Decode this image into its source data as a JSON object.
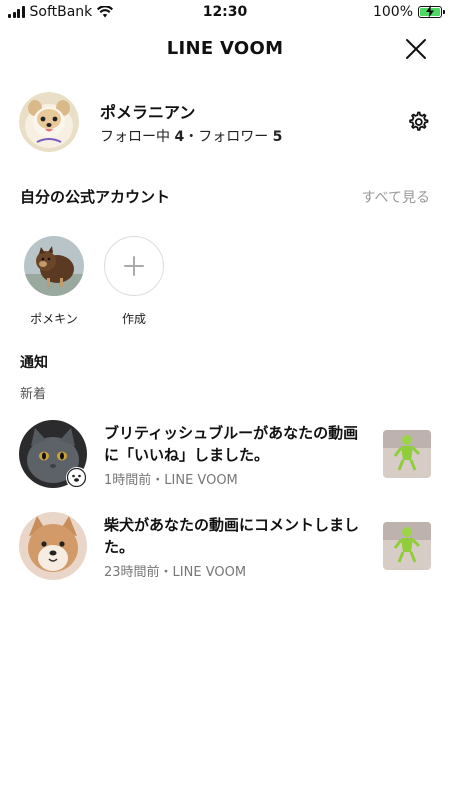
{
  "status_bar": {
    "carrier": "SoftBank",
    "time": "12:30",
    "battery": "100%"
  },
  "header": {
    "title": "LINE VOOM"
  },
  "profile": {
    "name": "ポメラニアン",
    "following_label": "フォロー中",
    "following_count": "4",
    "separator": "・",
    "followers_label": "フォロワー",
    "followers_count": "5"
  },
  "official_accounts": {
    "title": "自分の公式アカウント",
    "see_all": "すべて見る",
    "items": [
      {
        "label": "ポメキン"
      },
      {
        "label": "作成"
      }
    ]
  },
  "notifications": {
    "title": "通知",
    "subtitle": "新着",
    "items": [
      {
        "text": "ブリティッシュブルーがあなたの動画に「いいね」しました。",
        "meta": "1時間前・LINE VOOM"
      },
      {
        "text": "柴犬があなたの動画にコメントしました。",
        "meta": "23時間前・LINE VOOM"
      }
    ]
  },
  "colors": {
    "battery_fill": "#4cd964",
    "secondary_text": "#999999",
    "meta_text": "#777777"
  }
}
